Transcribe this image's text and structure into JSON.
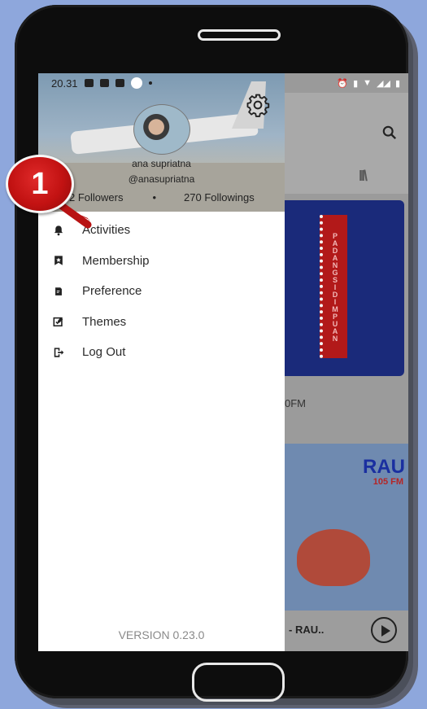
{
  "status_bar": {
    "time": "20.31"
  },
  "profile": {
    "name": "ana supriatna",
    "handle": "@anasupriatna",
    "followers": "2 Followers",
    "separator": "•",
    "followings": "270 Followings"
  },
  "menu": {
    "items": [
      {
        "label": "Activities",
        "icon": "bell-icon"
      },
      {
        "label": "Membership",
        "icon": "bookmark-star-icon"
      },
      {
        "label": "Preference",
        "icon": "document-icon"
      },
      {
        "label": "Themes",
        "icon": "edit-check-icon"
      },
      {
        "label": "Log Out",
        "icon": "logout-icon"
      }
    ]
  },
  "version": "VERSION 0.23.0",
  "background_app": {
    "station_label": "PADANGSIDIMPUAN",
    "fm_text": "0FM",
    "rau_logo": "RAU",
    "rau_sub": "105 FM",
    "player_title": "- RAU.."
  },
  "callout": {
    "number": "1"
  },
  "colors": {
    "page_bg": "#8ea7dc",
    "callout_red": "#c21212",
    "drawer_bg": "#ffffff"
  }
}
